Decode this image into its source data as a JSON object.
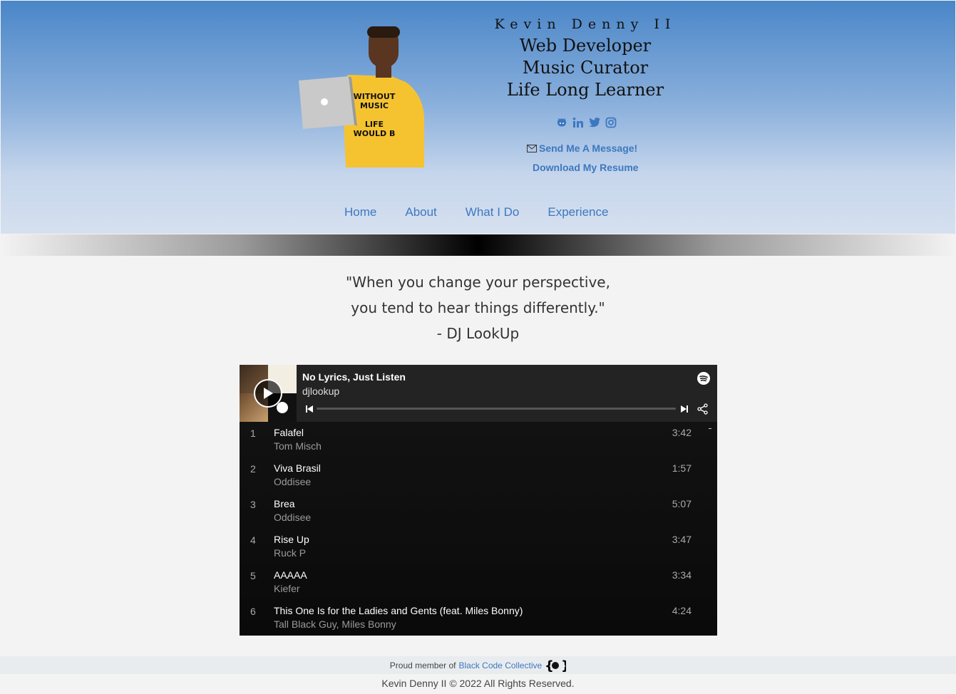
{
  "header": {
    "name": "Kevin Denny II",
    "roles": [
      "Web Developer",
      "Music Curator",
      "Life Long Learner"
    ],
    "avatar_text": [
      "WITHOUT",
      "MUSIC",
      "LIFE",
      "WOULD B"
    ],
    "socials": [
      "github-icon",
      "linkedin-icon",
      "twitter-icon",
      "instagram-icon"
    ],
    "send_message": "Send Me A Message!",
    "download_resume": "Download My Resume"
  },
  "nav": {
    "items": [
      "Home",
      "About",
      "What I Do",
      "Experience"
    ]
  },
  "quote": {
    "line1": "\"When you change your perspective,",
    "line2": "you tend to hear things differently.\"",
    "line3": "- DJ LookUp"
  },
  "player": {
    "title": "No Lyrics, Just Listen",
    "owner": "djlookup",
    "tracks": [
      {
        "num": "1",
        "title": "Falafel",
        "artist": "Tom Misch",
        "duration": "3:42"
      },
      {
        "num": "2",
        "title": "Viva Brasil",
        "artist": "Oddisee",
        "duration": "1:57"
      },
      {
        "num": "3",
        "title": "Brea",
        "artist": "Oddisee",
        "duration": "5:07"
      },
      {
        "num": "4",
        "title": "Rise Up",
        "artist": "Ruck P",
        "duration": "3:47"
      },
      {
        "num": "5",
        "title": "AAAAA",
        "artist": "Kiefer",
        "duration": "3:34"
      },
      {
        "num": "6",
        "title": "This One Is for the Ladies and Gents (feat. Miles Bonny)",
        "artist": "Tall Black Guy, Miles Bonny",
        "duration": "4:24"
      }
    ]
  },
  "footer": {
    "member_prefix": "Proud member of",
    "member_link": "Black Code Collective",
    "copyright": "Kevin Denny II © 2022 All Rights Reserved."
  },
  "colors": {
    "accent": "#3c78c0",
    "header_top": "#4a86c8",
    "player_bg": "#141414"
  }
}
